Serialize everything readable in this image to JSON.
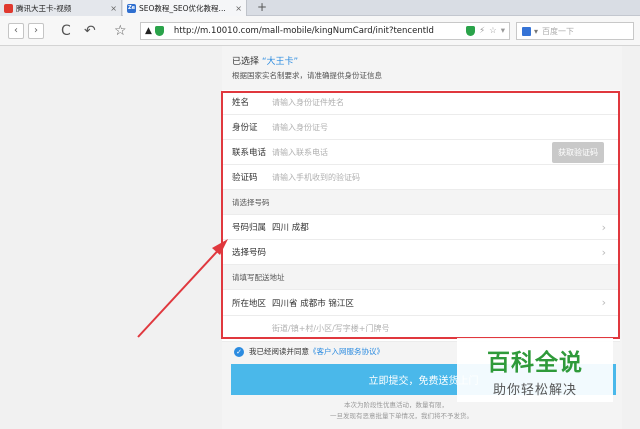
{
  "tabs": [
    {
      "title": "腾讯大王卡-视频",
      "close": "×"
    },
    {
      "title": "SEO教程_SEO优化教程...",
      "close": "×",
      "favicon_text": "Ze"
    }
  ],
  "new_tab": "+",
  "toolbar": {
    "back": "‹",
    "forward": "›",
    "reload": "C",
    "undo": "↶",
    "favorite": "☆",
    "url": "http://m.10010.com/mall-mobile/kingNumCard/init?tencentId",
    "search_placeholder": "百度一下"
  },
  "page": {
    "selected_prefix": "已选择",
    "selected_card": "“大王卡”",
    "notice": "根据国家实名制要求，请准确提供身份证信息",
    "form": {
      "name_label": "姓名",
      "name_placeholder": "请输入身份证件姓名",
      "id_label": "身份证",
      "id_placeholder": "请输入身份证号",
      "phone_label": "联系电话",
      "phone_placeholder": "请输入联系电话",
      "get_code_button": "获取验证码",
      "code_label": "验证码",
      "code_placeholder": "请输入手机收到的验证码",
      "section_number": "请选择号码",
      "region_label": "号码归属",
      "region_value": "四川 成都",
      "choose_number_label": "选择号码",
      "section_address": "请填写配送地址",
      "area_label": "所在地区",
      "area_value": "四川省 成都市 锦江区",
      "street_placeholder": "街道/镇+村/小区/写字楼+门牌号"
    },
    "agree_prefix": "我已经阅读并同意",
    "agree_link": "《客户入网服务协议》",
    "submit_label": "立即提交，免费送货上门",
    "footer_line1": "本次为阶段性优惠活动，数量有限，",
    "footer_line2": "一旦发现有恶意批量下单情况，我们将不予发货。"
  },
  "watermark": {
    "title": "百科全说",
    "subtitle": "助你轻松解决"
  },
  "colors": {
    "accent": "#2b8be0",
    "submit": "#4ab8ea",
    "highlight": "#e0383e",
    "watermark": "#2f9a3a"
  }
}
